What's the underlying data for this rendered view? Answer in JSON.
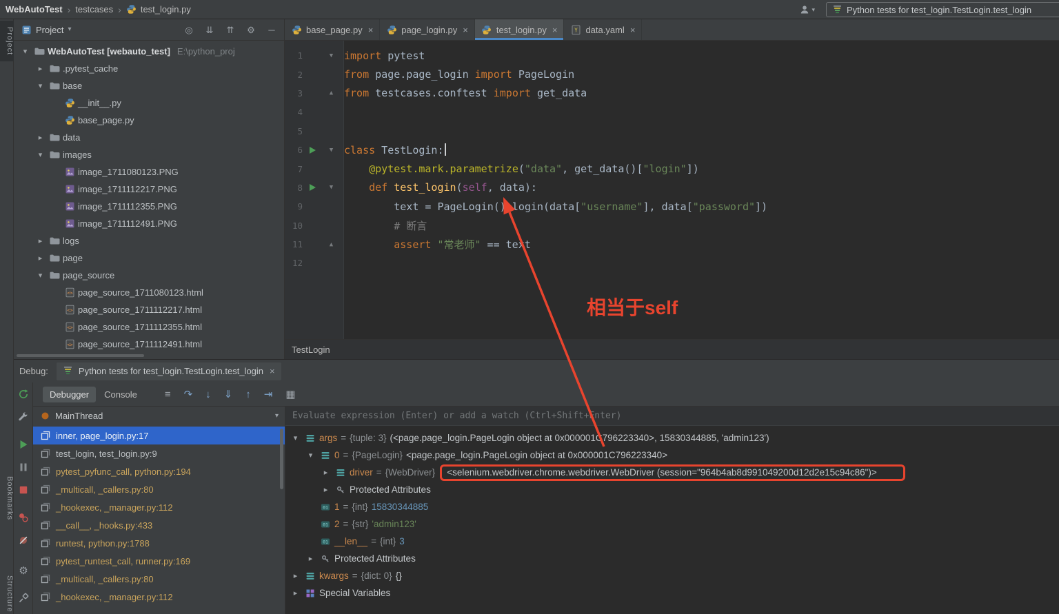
{
  "top_bar": {
    "separator": "›",
    "breadcrumbs": [
      {
        "label": "WebAutoTest",
        "bold": true
      },
      {
        "label": "testcases"
      },
      {
        "label": "test_login.py",
        "icon": "python-icon"
      }
    ],
    "run_config": {
      "icon": "pytest-icon",
      "label": "Python tests for test_login.TestLogin.test_login"
    }
  },
  "left_stripe": {
    "top_label": "Project",
    "bottom_labels": [
      "Bookmarks",
      "Structure"
    ]
  },
  "project_panel": {
    "header": {
      "icon": "project-icon",
      "title": "Project",
      "chevron": "chevron-down-icon",
      "actions": [
        "locate-icon",
        "expand-all-icon",
        "collapse-all-icon",
        "settings-icon",
        "hide-icon"
      ]
    },
    "tree": [
      {
        "level": 0,
        "chevron": "expanded",
        "icon": "folder",
        "label": "WebAutoTest [webauto_test]",
        "bold": true,
        "suffix": "E:\\python_proj"
      },
      {
        "level": 1,
        "chevron": "collapsed",
        "icon": "folder",
        "label": ".pytest_cache"
      },
      {
        "level": 1,
        "chevron": "expanded",
        "icon": "folder",
        "label": "base"
      },
      {
        "level": 2,
        "icon": "python",
        "label": "__init__.py"
      },
      {
        "level": 2,
        "icon": "python",
        "label": "base_page.py"
      },
      {
        "level": 1,
        "chevron": "collapsed",
        "icon": "folder",
        "label": "data"
      },
      {
        "level": 1,
        "chevron": "expanded",
        "icon": "folder",
        "label": "images"
      },
      {
        "level": 2,
        "icon": "image",
        "label": "image_1711080123.PNG"
      },
      {
        "level": 2,
        "icon": "image",
        "label": "image_1711112217.PNG"
      },
      {
        "level": 2,
        "icon": "image",
        "label": "image_1711112355.PNG"
      },
      {
        "level": 2,
        "icon": "image",
        "label": "image_1711112491.PNG"
      },
      {
        "level": 1,
        "chevron": "collapsed",
        "icon": "folder",
        "label": "logs"
      },
      {
        "level": 1,
        "chevron": "collapsed",
        "icon": "folder",
        "label": "page"
      },
      {
        "level": 1,
        "chevron": "expanded",
        "icon": "folder",
        "label": "page_source"
      },
      {
        "level": 2,
        "icon": "html",
        "label": "page_source_1711080123.html"
      },
      {
        "level": 2,
        "icon": "html",
        "label": "page_source_1711112217.html"
      },
      {
        "level": 2,
        "icon": "html",
        "label": "page_source_1711112355.html"
      },
      {
        "level": 2,
        "icon": "html",
        "label": "page_source_1711112491.html"
      }
    ]
  },
  "editor": {
    "close_glyph": "×",
    "tabs": [
      {
        "label": "base_page.py",
        "icon": "python",
        "active": false
      },
      {
        "label": "page_login.py",
        "icon": "python",
        "active": false
      },
      {
        "label": "test_login.py",
        "icon": "python",
        "active": true
      },
      {
        "label": "data.yaml",
        "icon": "yaml",
        "active": false
      }
    ],
    "breadcrumb": "TestLogin",
    "code": {
      "lines": [
        {
          "num": 1,
          "fold": "down",
          "tokens": [
            [
              "kw",
              "import"
            ],
            [
              "pl",
              " pytest"
            ]
          ]
        },
        {
          "num": 2,
          "tokens": [
            [
              "kw",
              "from"
            ],
            [
              "pl",
              " page.page_login "
            ],
            [
              "kw",
              "import"
            ],
            [
              "pl",
              " PageLogin"
            ]
          ]
        },
        {
          "num": 3,
          "fold": "up",
          "tokens": [
            [
              "kw",
              "from"
            ],
            [
              "pl",
              " testcases.conftest "
            ],
            [
              "kw",
              "import"
            ],
            [
              "pl",
              " get_data"
            ]
          ]
        },
        {
          "num": 4,
          "tokens": []
        },
        {
          "num": 5,
          "tokens": []
        },
        {
          "num": 6,
          "run": true,
          "fold": "down",
          "tokens": [
            [
              "kw",
              "class"
            ],
            [
              "pl",
              " TestLogin:"
            ],
            [
              "cursor",
              ""
            ]
          ]
        },
        {
          "num": 7,
          "tokens": [
            [
              "pl",
              "    "
            ],
            [
              "deco",
              "@pytest.mark.parametrize"
            ],
            [
              "pl",
              "("
            ],
            [
              "str",
              "\"data\""
            ],
            [
              "pl",
              ", get_data()["
            ],
            [
              "str",
              "\"login\""
            ],
            [
              "pl",
              "])"
            ]
          ]
        },
        {
          "num": 8,
          "run": true,
          "fold": "down",
          "tokens": [
            [
              "pl",
              "    "
            ],
            [
              "kw",
              "def"
            ],
            [
              "pl",
              " "
            ],
            [
              "fn",
              "test_login"
            ],
            [
              "pl",
              "("
            ],
            [
              "self",
              "self"
            ],
            [
              "pl",
              ", data):"
            ]
          ]
        },
        {
          "num": 9,
          "tokens": [
            [
              "pl",
              "        text = PageLogin().login(data["
            ],
            [
              "str",
              "\"username\""
            ],
            [
              "pl",
              "], data["
            ],
            [
              "str",
              "\"password\""
            ],
            [
              "pl",
              "])"
            ]
          ]
        },
        {
          "num": 10,
          "tokens": [
            [
              "cm",
              "        # 断言"
            ]
          ]
        },
        {
          "num": 11,
          "fold": "up",
          "tokens": [
            [
              "pl",
              "        "
            ],
            [
              "kw",
              "assert"
            ],
            [
              "pl",
              " "
            ],
            [
              "str",
              "\"常老师\""
            ],
            [
              "pl",
              " == text"
            ]
          ]
        },
        {
          "num": 12,
          "tokens": []
        }
      ]
    }
  },
  "debug_panel": {
    "label": "Debug:",
    "tab": {
      "icon": "pytest-icon",
      "label": "Python tests for test_login.TestLogin.test_login",
      "close": "×"
    },
    "toolbar": {
      "tabs": [
        {
          "label": "Debugger",
          "active": true
        },
        {
          "label": "Console",
          "active": false
        }
      ],
      "icons": [
        "menu-icon",
        "step-over-icon",
        "step-into-icon",
        "force-step-into-icon",
        "step-out-icon",
        "run-to-cursor-icon",
        "table-icon"
      ]
    },
    "strip_icons": [
      "rerun-icon",
      "wrench-icon",
      "resume-icon",
      "pause-icon",
      "stop-icon",
      "view-breakpoints-icon",
      "mute-breakpoints-icon",
      "settings-icon",
      "pin-icon"
    ],
    "frames": {
      "thread": {
        "icon": "thread-icon",
        "label": "MainThread",
        "chevron": "chevron-down-icon"
      },
      "items": [
        {
          "label": "inner, page_login.py:17",
          "selected": true,
          "lib": false
        },
        {
          "label": "test_login, test_login.py:9",
          "lib": false
        },
        {
          "label": "pytest_pyfunc_call, python.py:194",
          "lib": true
        },
        {
          "label": "_multicall, _callers.py:80",
          "lib": true
        },
        {
          "label": "_hookexec, _manager.py:112",
          "lib": true
        },
        {
          "label": "__call__, _hooks.py:433",
          "lib": true
        },
        {
          "label": "runtest, python.py:1788",
          "lib": true
        },
        {
          "label": "pytest_runtest_call, runner.py:169",
          "lib": true
        },
        {
          "label": "_multicall, _callers.py:80",
          "lib": true
        },
        {
          "label": "_hookexec, _manager.py:112",
          "lib": true
        }
      ]
    },
    "variables": {
      "evaluate_placeholder": "Evaluate expression (Enter) or add a watch (Ctrl+Shift+Enter)",
      "items": [
        {
          "level": 0,
          "chevron": "expanded",
          "icon": "collection",
          "name": "args",
          "type": "{tuple: 3}",
          "value": "(<page.page_login.PageLogin object at 0x000001C796223340>, 15830344885, 'admin123')"
        },
        {
          "level": 1,
          "chevron": "expanded",
          "icon": "collection",
          "name": "0",
          "type": "{PageLogin}",
          "value": "<page.page_login.PageLogin object at 0x000001C796223340>"
        },
        {
          "level": 2,
          "chevron": "collapsed",
          "icon": "collection",
          "name": "driver",
          "type": "{WebDriver}",
          "value": "<selenium.webdriver.chrome.webdriver.WebDriver (session=\"964b4ab8d991049200d12d2e15c94c86\")>",
          "highlighted": true
        },
        {
          "level": 2,
          "chevron": "collapsed",
          "icon": "protected",
          "group": "Protected Attributes"
        },
        {
          "level": 1,
          "icon": "primitive",
          "name": "1",
          "type": "{int}",
          "value": "15830344885",
          "vclass": "num"
        },
        {
          "level": 1,
          "icon": "primitive",
          "name": "2",
          "type": "{str}",
          "value": "'admin123'",
          "vclass": "str"
        },
        {
          "level": 1,
          "icon": "primitive",
          "name": "__len__",
          "type": "{int}",
          "value": "3",
          "vclass": "num"
        },
        {
          "level": 1,
          "chevron": "collapsed",
          "icon": "protected",
          "group": "Protected Attributes"
        },
        {
          "level": 0,
          "chevron": "collapsed",
          "icon": "collection",
          "name": "kwargs",
          "type": "{dict: 0}",
          "value": "{}"
        },
        {
          "level": 0,
          "chevron": "collapsed",
          "icon": "special",
          "group": "Special Variables"
        }
      ]
    }
  },
  "annotations": {
    "callout_text": "相当于self"
  }
}
